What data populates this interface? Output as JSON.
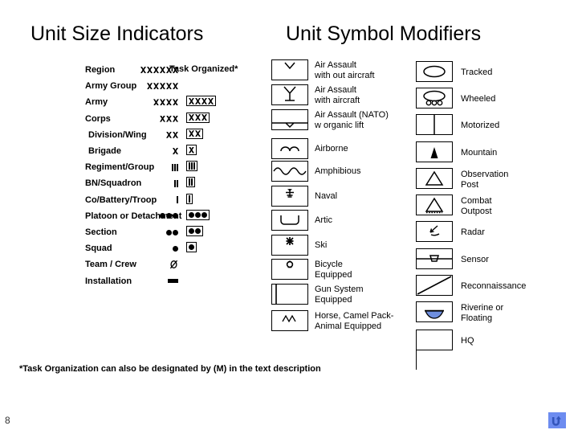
{
  "slide": {
    "page_number": "8",
    "footnote": "*Task Organization can also be designated by (M) in the text description"
  },
  "left_panel": {
    "title": "Unit Size Indicators",
    "task_column_header": "Task Organized*",
    "rows": [
      {
        "label": "Region",
        "symbol": "six-x",
        "task_organized": false
      },
      {
        "label": "Army Group",
        "symbol": "five-x",
        "task_organized": false
      },
      {
        "label": "Army",
        "symbol": "four-x",
        "task_organized": true
      },
      {
        "label": "Corps",
        "symbol": "three-x",
        "task_organized": true
      },
      {
        "label": "Division/Wing",
        "symbol": "two-x",
        "task_organized": true
      },
      {
        "label": "Brigade",
        "symbol": "one-x",
        "task_organized": true
      },
      {
        "label": "Regiment/Group",
        "symbol": "three-bar",
        "task_organized": true
      },
      {
        "label": "BN/Squadron",
        "symbol": "two-bar",
        "task_organized": true
      },
      {
        "label": "Co/Battery/Troop",
        "symbol": "one-bar",
        "task_organized": true
      },
      {
        "label": "Platoon or Detachment",
        "symbol": "three-dot",
        "task_organized": true
      },
      {
        "label": "Section",
        "symbol": "two-dot",
        "task_organized": true
      },
      {
        "label": "Squad",
        "symbol": "one-dot",
        "task_organized": true
      },
      {
        "label": "Team / Crew",
        "symbol": "slashed-oval",
        "task_organized": false
      },
      {
        "label": "Installation",
        "symbol": "filled-rect",
        "task_organized": false
      }
    ]
  },
  "right_panel": {
    "title": "Unit Symbol Modifiers",
    "column_one": [
      {
        "icon": "air-assault-without-aircraft-icon",
        "lines": [
          "Air Assault",
          "with out aircraft"
        ]
      },
      {
        "icon": "air-assault-with-aircraft-icon",
        "lines": [
          "Air Assault",
          "with aircraft"
        ]
      },
      {
        "icon": "air-assault-nato-icon",
        "lines": [
          "Air Assault (NATO)",
          "w organic lift"
        ]
      },
      {
        "icon": "airborne-icon",
        "lines": [
          "Airborne"
        ]
      },
      {
        "icon": "amphibious-icon",
        "lines": [
          "Amphibious"
        ]
      },
      {
        "icon": "naval-icon",
        "lines": [
          "Naval"
        ]
      },
      {
        "icon": "artic-icon",
        "lines": [
          "Artic"
        ]
      },
      {
        "icon": "ski-icon",
        "lines": [
          "Ski"
        ]
      },
      {
        "icon": "bicycle-equipped-icon",
        "lines": [
          "Bicycle",
          "Equipped"
        ]
      },
      {
        "icon": "gun-system-equipped-icon",
        "lines": [
          "Gun System",
          "Equipped"
        ]
      },
      {
        "icon": "horse-camel-pack-icon",
        "lines": [
          "Horse, Camel Pack-",
          "Animal Equipped"
        ]
      }
    ],
    "column_two": [
      {
        "icon": "tracked-icon",
        "lines": [
          "Tracked"
        ]
      },
      {
        "icon": "wheeled-icon",
        "lines": [
          "Wheeled"
        ]
      },
      {
        "icon": "motorized-icon",
        "lines": [
          "Motorized"
        ]
      },
      {
        "icon": "mountain-icon",
        "lines": [
          "Mountain"
        ]
      },
      {
        "icon": "observation-post-icon",
        "lines": [
          "Observation",
          "Post"
        ]
      },
      {
        "icon": "combat-outpost-icon",
        "lines": [
          "Combat",
          "Outpost"
        ]
      },
      {
        "icon": "radar-icon",
        "lines": [
          "Radar"
        ]
      },
      {
        "icon": "sensor-icon",
        "lines": [
          "Sensor"
        ]
      },
      {
        "icon": "reconnaissance-icon",
        "lines": [
          "Reconnaissance"
        ]
      },
      {
        "icon": "riverine-floating-icon",
        "lines": [
          "Riverine or",
          "Floating"
        ]
      },
      {
        "icon": "headquarters-icon",
        "lines": [
          "HQ"
        ]
      }
    ]
  },
  "colors": {
    "ink": "#000000",
    "background": "#ffffff",
    "riverine_fill": "#6f8fdf",
    "button_background": "#6d8cf0",
    "button_glyph": "#3355bb"
  },
  "return_button": {
    "icon": "return-arrow-icon"
  }
}
